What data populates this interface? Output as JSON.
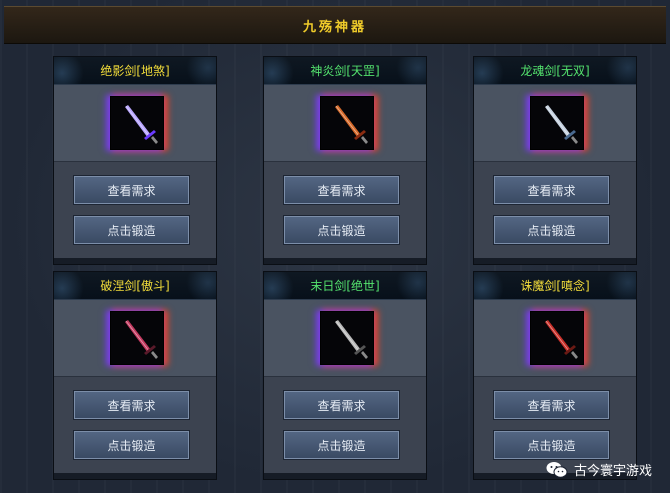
{
  "header": {
    "title": "九殇神器"
  },
  "buttons": {
    "view": "查看需求",
    "forge": "点击锻造"
  },
  "cards": [
    {
      "name": "绝影剑[地煞]",
      "name_color": "yellow",
      "blade": "#b9a6ff",
      "guard": "#6b3bff"
    },
    {
      "name": "神炎剑[天罡]",
      "name_color": "green",
      "blade": "#d66a2a",
      "guard": "#8a2b10"
    },
    {
      "name": "龙魂剑[无双]",
      "name_color": "green",
      "blade": "#c6d2e0",
      "guard": "#4a6a90"
    },
    {
      "name": "破涅剑[傲斗]",
      "name_color": "yellow",
      "blade": "#c33a60",
      "guard": "#5a1a2a"
    },
    {
      "name": "末日剑[绝世]",
      "name_color": "green",
      "blade": "#b8b8b8",
      "guard": "#555555"
    },
    {
      "name": "诛魔剑[嗔念]",
      "name_color": "yellow",
      "blade": "#c9302a",
      "guard": "#6b1a14"
    }
  ],
  "watermark": {
    "text": "古今寰宇游戏",
    "icon": "wechat-icon"
  }
}
